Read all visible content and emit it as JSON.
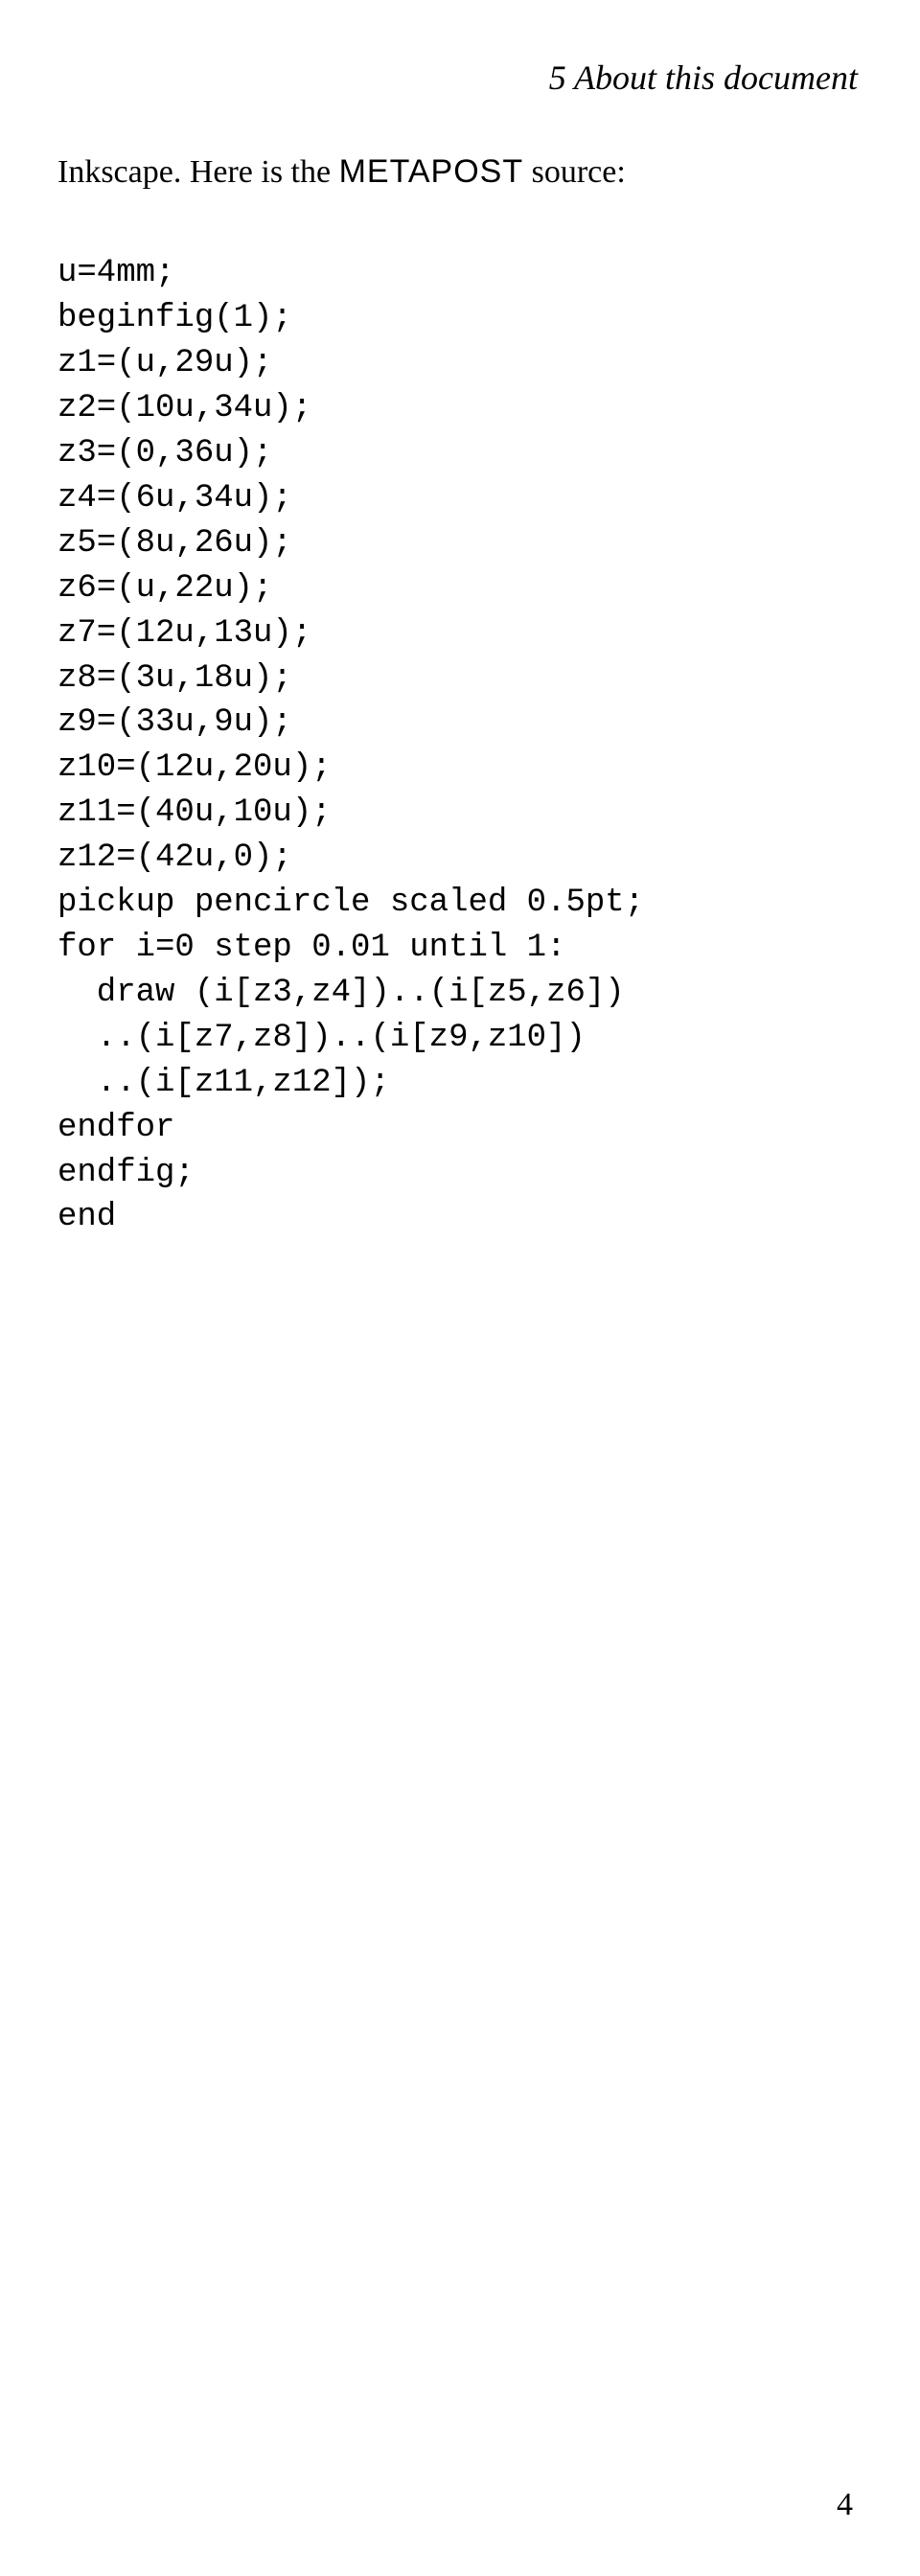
{
  "running_head": "5  About this document",
  "body": {
    "text_before": "Inkscape.    Here  is  the  ",
    "metapost_word": "METAPOST",
    "text_after": " source:"
  },
  "code_lines": [
    "u=4mm;",
    "beginfig(1);",
    "z1=(u,29u);",
    "z2=(10u,34u);",
    "z3=(0,36u);",
    "z4=(6u,34u);",
    "z5=(8u,26u);",
    "z6=(u,22u);",
    "z7=(12u,13u);",
    "z8=(3u,18u);",
    "z9=(33u,9u);",
    "z10=(12u,20u);",
    "z11=(40u,10u);",
    "z12=(42u,0);",
    "pickup pencircle scaled 0.5pt;",
    "for i=0 step 0.01 until 1:",
    "  draw (i[z3,z4])..(i[z5,z6])",
    "  ..(i[z7,z8])..(i[z9,z10])",
    "  ..(i[z11,z12]);",
    "endfor",
    "endfig;",
    "end"
  ],
  "page_number": "4"
}
